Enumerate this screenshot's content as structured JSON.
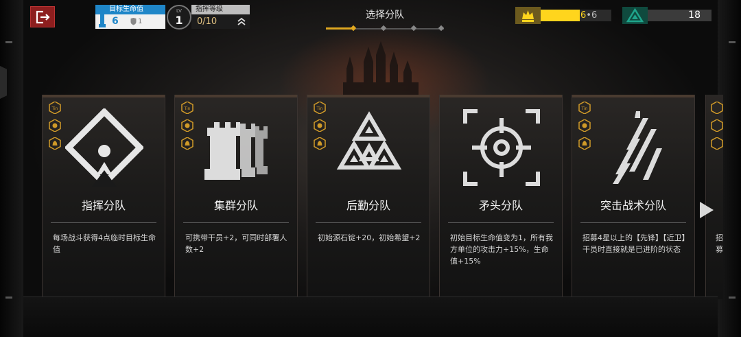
{
  "header": {
    "exit_icon": "exit-door-icon",
    "life_points": {
      "label": "目标生命值",
      "value": "6",
      "shield_value": "1",
      "icon": "tower-icon"
    },
    "level": {
      "label": "LV",
      "value": "1"
    },
    "command": {
      "label": "指挥等级",
      "value": "0/10",
      "icon": "rank-chevron-icon"
    },
    "title": "选择分队",
    "progress_steps": 4,
    "progress_current": 1,
    "ingot": {
      "icon": "crown-ingot-icon",
      "current": "6",
      "separator": "•",
      "max": "6",
      "fill_ratio": 0.55,
      "color": "#ffd51d"
    },
    "hope": {
      "icon": "green-triangle-icon",
      "value": "18",
      "color": "#1fa58c"
    }
  },
  "cards": [
    {
      "name": "指挥分队",
      "emblem": "command-squad-emblem-icon",
      "description": "每场战斗获得4点临时目标生命值"
    },
    {
      "name": "集群分队",
      "emblem": "cluster-squad-rook-emblem-icon",
      "description": "可携带干员+2，可同时部署人数+2"
    },
    {
      "name": "后勤分队",
      "emblem": "logistics-squad-triangle-emblem-icon",
      "description": "初始源石锭+20，初始希望+2"
    },
    {
      "name": "矛头分队",
      "emblem": "spearhead-squad-crosshair-emblem-icon",
      "description": "初始目标生命值变为1，所有我方单位的攻击力+15%，生命值+15%"
    },
    {
      "name": "突击战术分队",
      "emblem": "assault-tactics-squad-sword-emblem-icon",
      "description": "招募4星以上的【先锋】【近卫】干员时直接就是已进阶的状态"
    }
  ],
  "partial_card": {
    "text": "招募"
  },
  "card_tags": [
    "tin-coin-icon",
    "lion-head-icon",
    "bell-icon"
  ]
}
